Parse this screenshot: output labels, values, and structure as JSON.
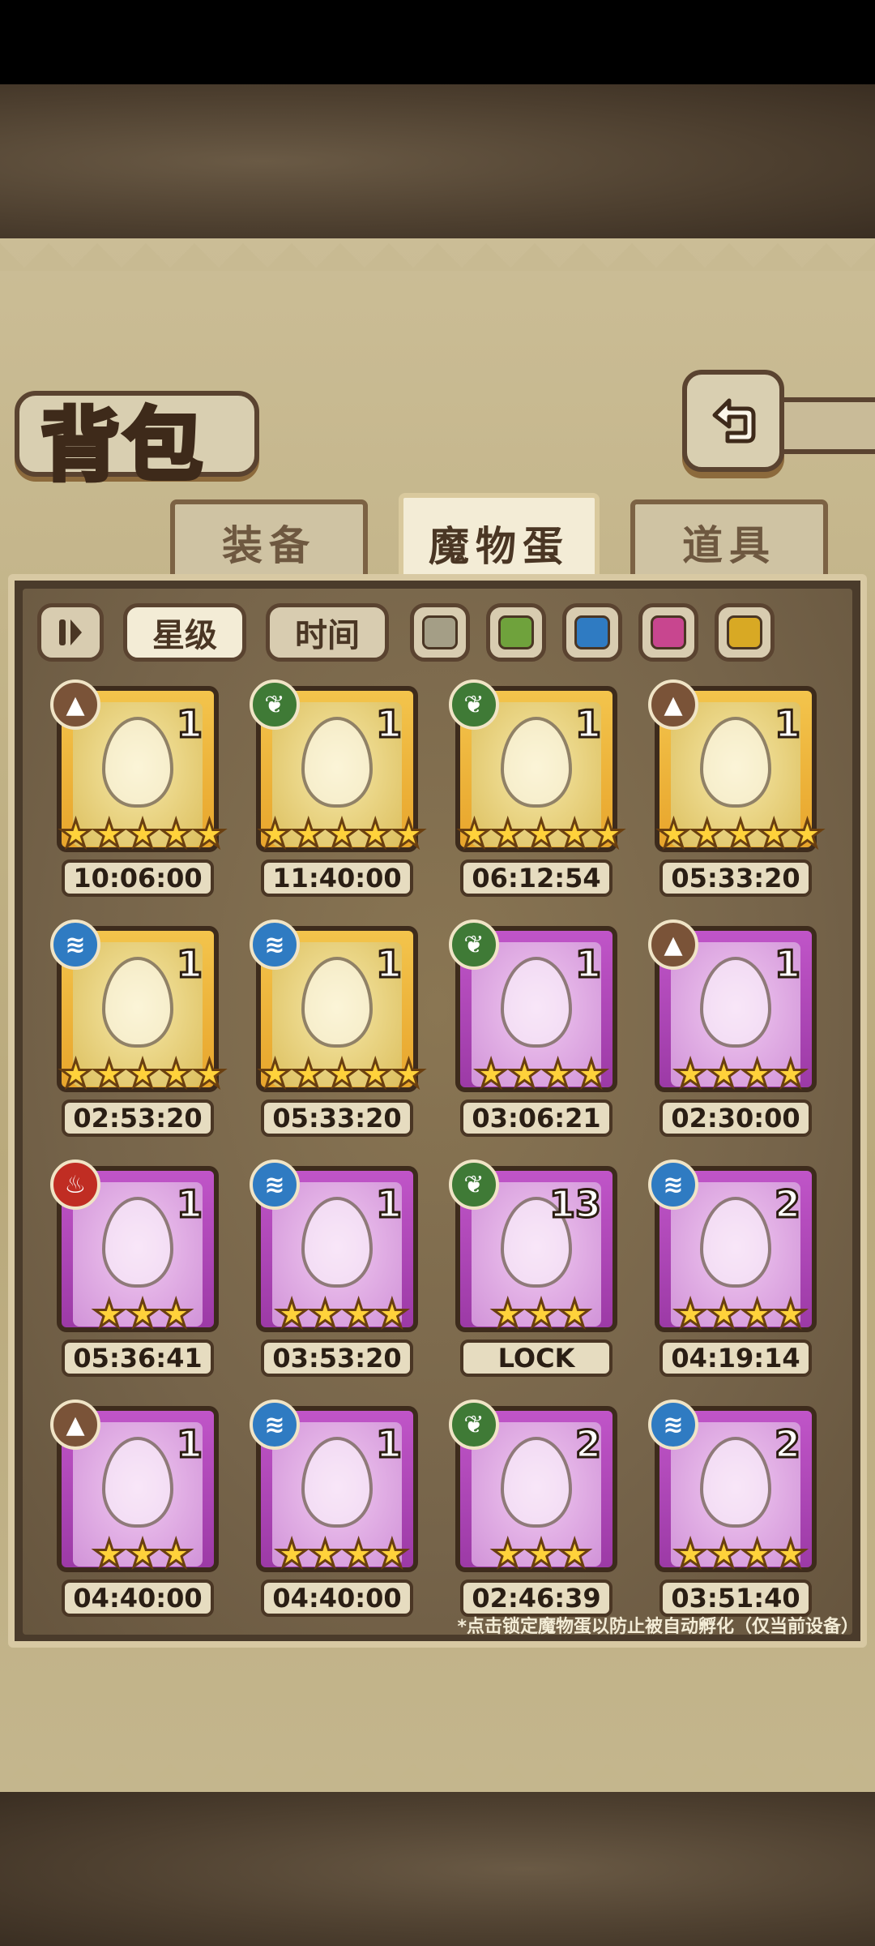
{
  "title": "背包",
  "back_icon": "back-arrow-icon",
  "tabs": [
    {
      "label": "装备",
      "active": false
    },
    {
      "label": "魔物蛋",
      "active": true
    },
    {
      "label": "道具",
      "active": false
    }
  ],
  "filters": {
    "sort_icon": "sort-toggle-icon",
    "star_label": "星级",
    "time_label": "时间",
    "swatches": [
      {
        "name": "gray",
        "color": "#a49e86"
      },
      {
        "name": "green",
        "color": "#6fa23c"
      },
      {
        "name": "blue",
        "color": "#2f7bc2"
      },
      {
        "name": "pink",
        "color": "#c8468f"
      },
      {
        "name": "yellow",
        "color": "#d8a924"
      }
    ]
  },
  "eggs": [
    {
      "element": "earth",
      "element_icon": "earth-element-icon",
      "qty": "1",
      "stars": 5,
      "rarity": "gold",
      "timer": "10:06:00",
      "art": "coffin-egg"
    },
    {
      "element": "leaf",
      "element_icon": "leaf-element-icon",
      "qty": "1",
      "stars": 5,
      "rarity": "gold",
      "timer": "11:40:00",
      "art": "angel-egg"
    },
    {
      "element": "leaf",
      "element_icon": "leaf-element-icon",
      "qty": "1",
      "stars": 5,
      "rarity": "gold",
      "timer": "06:12:54",
      "art": "wing-egg"
    },
    {
      "element": "earth",
      "element_icon": "earth-element-icon",
      "qty": "1",
      "stars": 5,
      "rarity": "gold",
      "timer": "05:33:20",
      "art": "hammer-egg"
    },
    {
      "element": "water",
      "element_icon": "water-element-icon",
      "qty": "1",
      "stars": 5,
      "rarity": "gold",
      "timer": "02:53:20",
      "art": "heart-egg"
    },
    {
      "element": "water",
      "element_icon": "water-element-icon",
      "qty": "1",
      "stars": 5,
      "rarity": "gold",
      "timer": "05:33:20",
      "art": "sword-egg"
    },
    {
      "element": "leaf",
      "element_icon": "leaf-element-icon",
      "qty": "1",
      "stars": 4,
      "rarity": "purple",
      "timer": "03:06:21",
      "art": "owl-egg"
    },
    {
      "element": "earth",
      "element_icon": "earth-element-icon",
      "qty": "1",
      "stars": 4,
      "rarity": "purple",
      "timer": "02:30:00",
      "art": "fur-egg"
    },
    {
      "element": "fire",
      "element_icon": "fire-element-icon",
      "qty": "1",
      "stars": 3,
      "rarity": "purple",
      "timer": "05:36:41",
      "art": "flag-egg"
    },
    {
      "element": "water",
      "element_icon": "water-element-icon",
      "qty": "1",
      "stars": 4,
      "rarity": "purple",
      "timer": "03:53:20",
      "art": "pudding-egg"
    },
    {
      "element": "leaf",
      "element_icon": "leaf-element-icon",
      "qty": "13",
      "stars": 3,
      "rarity": "purple",
      "timer": "LOCK",
      "art": "leaf-egg"
    },
    {
      "element": "water",
      "element_icon": "water-element-icon",
      "qty": "2",
      "stars": 4,
      "rarity": "purple",
      "timer": "04:19:14",
      "art": "slime-egg"
    },
    {
      "element": "earth",
      "element_icon": "earth-element-icon",
      "qty": "1",
      "stars": 3,
      "rarity": "purple",
      "timer": "04:40:00",
      "art": "mouse-egg"
    },
    {
      "element": "water",
      "element_icon": "water-element-icon",
      "qty": "1",
      "stars": 4,
      "rarity": "purple",
      "timer": "04:40:00",
      "art": "rabbit-egg"
    },
    {
      "element": "leaf",
      "element_icon": "leaf-element-icon",
      "qty": "2",
      "stars": 3,
      "rarity": "purple",
      "timer": "02:46:39",
      "art": "nest-egg"
    },
    {
      "element": "water",
      "element_icon": "water-element-icon",
      "qty": "2",
      "stars": 4,
      "rarity": "purple",
      "timer": "03:51:40",
      "art": "panda-egg"
    }
  ],
  "hint": "*点击锁定魔物蛋以防止被自动孵化（仅当前设备）"
}
